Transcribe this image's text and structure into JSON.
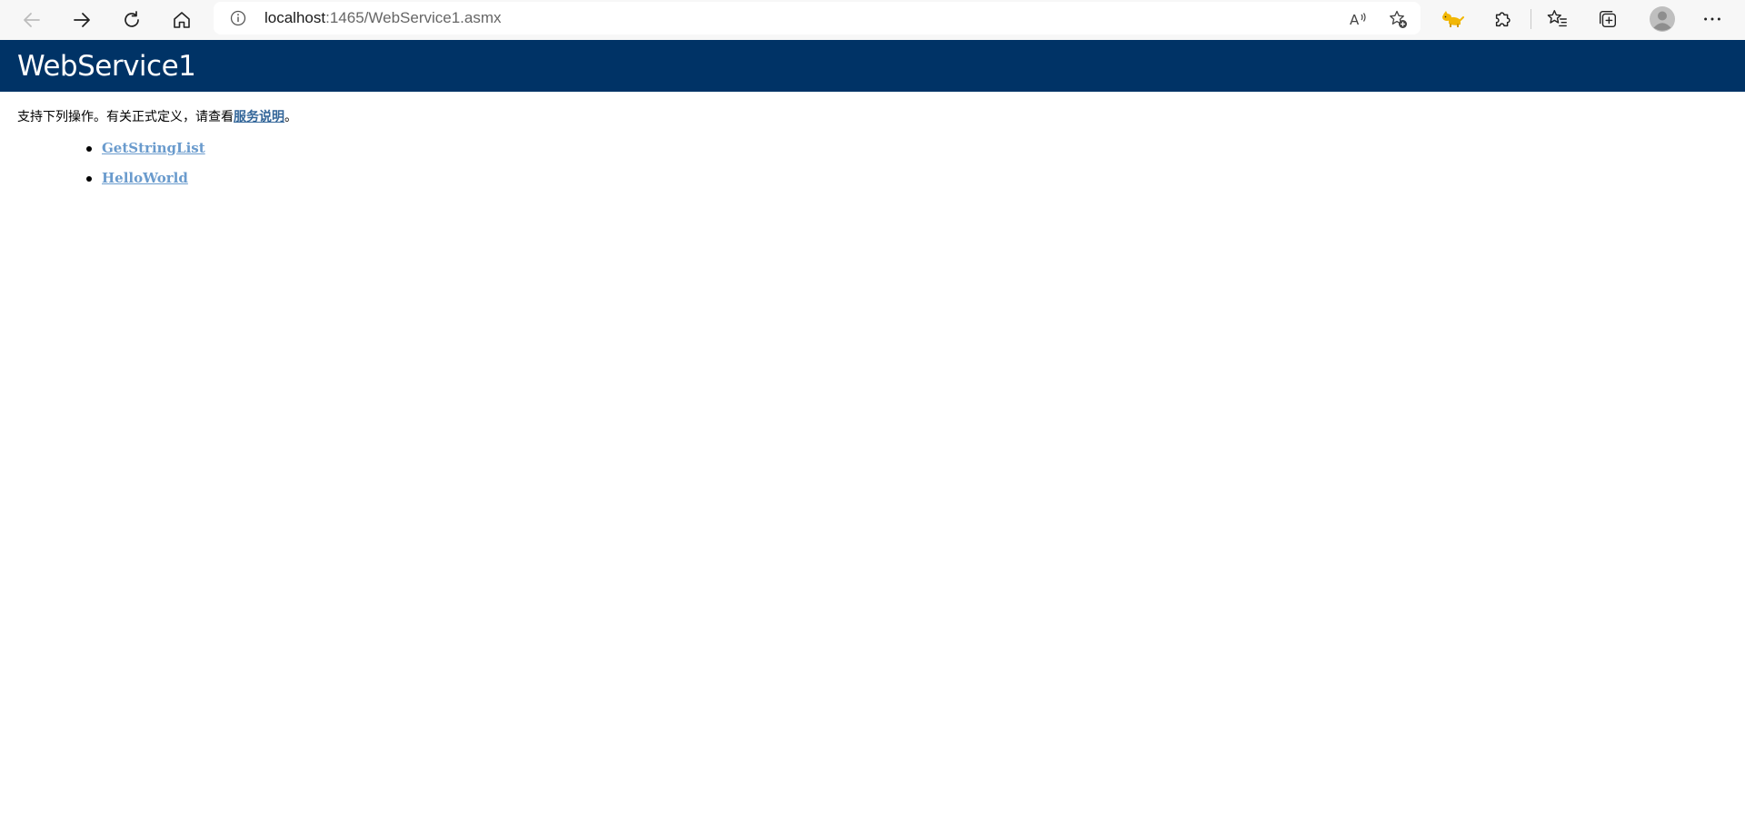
{
  "browser": {
    "url_host": "localhost",
    "url_rest": ":1465/WebService1.asmx",
    "icons": {
      "back": "arrow-left-icon",
      "forward": "arrow-right-icon",
      "refresh": "refresh-icon",
      "home": "home-icon",
      "site_info": "info-circle-icon",
      "read_aloud": "read-aloud-icon",
      "add_favorite": "star-plus-icon",
      "extension_cat": "cat-extension-icon",
      "extensions": "puzzle-icon",
      "favorites": "favorites-list-icon",
      "collections": "collections-icon",
      "profile": "avatar-icon",
      "more": "more-dots-icon"
    }
  },
  "page": {
    "title": "WebService1",
    "intro_text": "支持下列操作。有关正式定义，请查看",
    "intro_link": "服务说明",
    "intro_end": "。",
    "operations": [
      "GetStringList",
      "HelloWorld"
    ]
  },
  "colors": {
    "header_bg": "#003366",
    "link": "#336699",
    "op_link": "#6a9bcd"
  }
}
